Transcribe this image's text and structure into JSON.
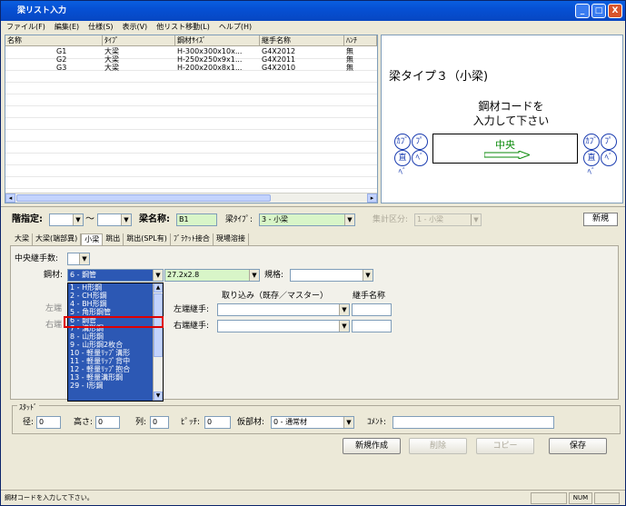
{
  "window": {
    "title": "梁リスト入力",
    "buttons": [
      "_",
      "□",
      "X"
    ]
  },
  "menu": [
    "ファイル(F)",
    "編集(E)",
    "仕様(S)",
    "表示(V)",
    "他リスト移動(L)",
    "ヘルプ(H)"
  ],
  "list": {
    "headers": [
      "名称",
      "ﾀｲﾌﾟ",
      "鋼材ｻｲｽﾞ",
      "継手名称",
      "ﾊﾝﾁ"
    ],
    "rows": [
      [
        "G1",
        "大梁",
        "H-300x300x10x...",
        "G4X2012",
        "無"
      ],
      [
        "G2",
        "大梁",
        "H-250x250x9x1...",
        "G4X2011",
        "無"
      ],
      [
        "G3",
        "大梁",
        "H-200x200x8x1...",
        "G4X2010",
        "無"
      ]
    ]
  },
  "preview": {
    "title": "梁タイプ３（小梁)",
    "msg1": "鋼材コードを",
    "msg2": "入力して下さい",
    "center": "中央",
    "left_top": "ｶﾌﾞ",
    "left_bot": "直ﾍﾞ",
    "right_top": "ｶﾌﾞ",
    "right_bot": "直ﾍﾞ"
  },
  "form": {
    "floor_label": "階指定:",
    "tilde": "〜",
    "name_label": "梁名称:",
    "name_value": "B1",
    "type_label": "梁ﾀｲﾌﾟ:",
    "type_value": "3 - 小梁",
    "agg_label": "集計区分:",
    "agg_value": "1 - 小梁",
    "new_badge": "新規"
  },
  "tabs": [
    "大梁",
    "大梁(端部異)",
    "小梁",
    "跳出",
    "跳出(SPL有)",
    "ﾌﾞﾗｹｯﾄ接合",
    "現場溶接"
  ],
  "panel": {
    "center_count_label": "中央継手数:",
    "steel_label": "鋼材:",
    "steel_value": "6 - 鋼管",
    "size_value": "27.2x2.8",
    "spec_label": "規格:",
    "left_label": "左端",
    "right_label": "右端",
    "import_header": "取り込み（既存／マスター）",
    "joint_header": "継手名称",
    "left_joint_label": "左端継手:",
    "right_joint_label": "右端継手:"
  },
  "dropdown": [
    "1 - H形鋼",
    "2 - CH形鋼",
    "4 - BH形鋼",
    "5 - 角形鋼管",
    "6 - 鋼管",
    "7 - 溝形鋼",
    "8 - 山形鋼",
    "9 - 山形鋼2枚合",
    "10 - 軽量ﾘｯﾌﾟ溝形",
    "11 - 軽量ﾘｯﾌﾟ背中",
    "12 - 軽量ﾘｯﾌﾟ抱合",
    "13 - 軽量溝形鋼",
    "29 - I形鋼"
  ],
  "stud": {
    "group": "ｽﾀｯﾄﾞ",
    "dia": "径:",
    "dia_v": "0",
    "height": "高さ:",
    "height_v": "0",
    "cols": "列:",
    "cols_v": "0",
    "pitch": "ﾋﾟｯﾁ:",
    "pitch_v": "0",
    "member": "仮部材:",
    "member_v": "0 - 通常材",
    "comment": "ｺﾒﾝﾄ:"
  },
  "buttons": {
    "create": "新規作成",
    "delete": "削除",
    "copy": "コピー",
    "save": "保存"
  },
  "status": {
    "text": "鋼材コードを入力して下さい。",
    "num": "NUM"
  }
}
